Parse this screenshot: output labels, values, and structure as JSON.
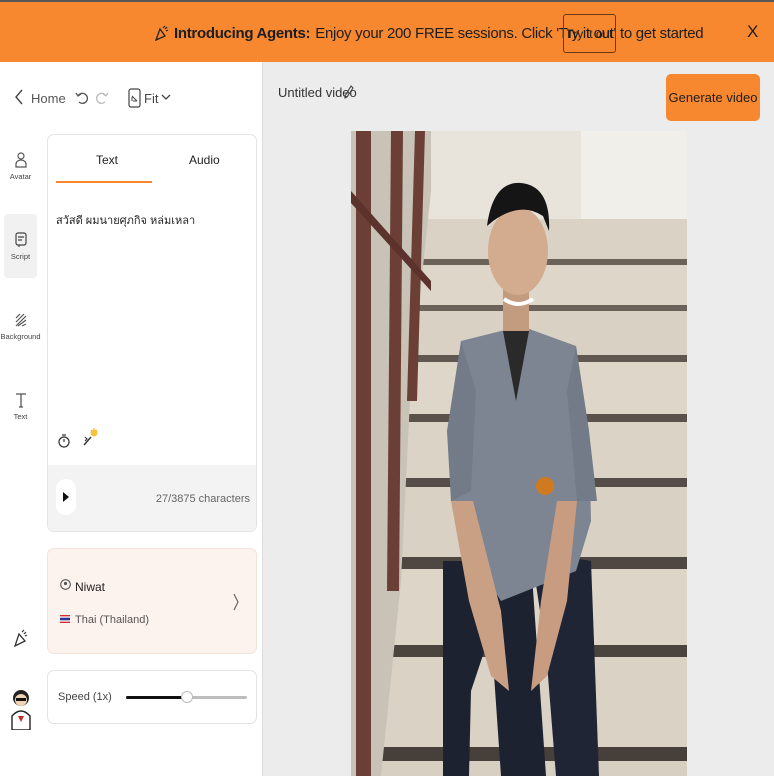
{
  "banner": {
    "title": "Introducing Agents:",
    "message": "Enjoy your 200 FREE sessions. Click 'Try it out' to get started",
    "cta_label": "Try it out",
    "close_label": "X",
    "icon": "party-popper-icon",
    "color": "#f7882f"
  },
  "topbar": {
    "home_label": "Home",
    "fit_label": "Fit"
  },
  "nav": {
    "items": [
      {
        "label": "Avatar",
        "icon": "person-icon"
      },
      {
        "label": "Script",
        "icon": "script-icon",
        "active": true
      },
      {
        "label": "Background",
        "icon": "background-icon"
      },
      {
        "label": "Text",
        "icon": "text-icon"
      }
    ]
  },
  "script": {
    "tabs": [
      "Text",
      "Audio"
    ],
    "active_tab": "Text",
    "content": "สวัสดี ผมนายศุภกิจ หล่มเหลา",
    "char_count": "27/3875 characters"
  },
  "voice": {
    "name": "Niwat",
    "language": "Thai (Thailand)",
    "flag": "thailand-flag-icon"
  },
  "speed": {
    "label": "Speed (1x)",
    "value_fraction": 0.5
  },
  "editor": {
    "video_title": "Untitled video",
    "generate_label": "Generate video"
  },
  "colors": {
    "accent": "#f7882f"
  }
}
